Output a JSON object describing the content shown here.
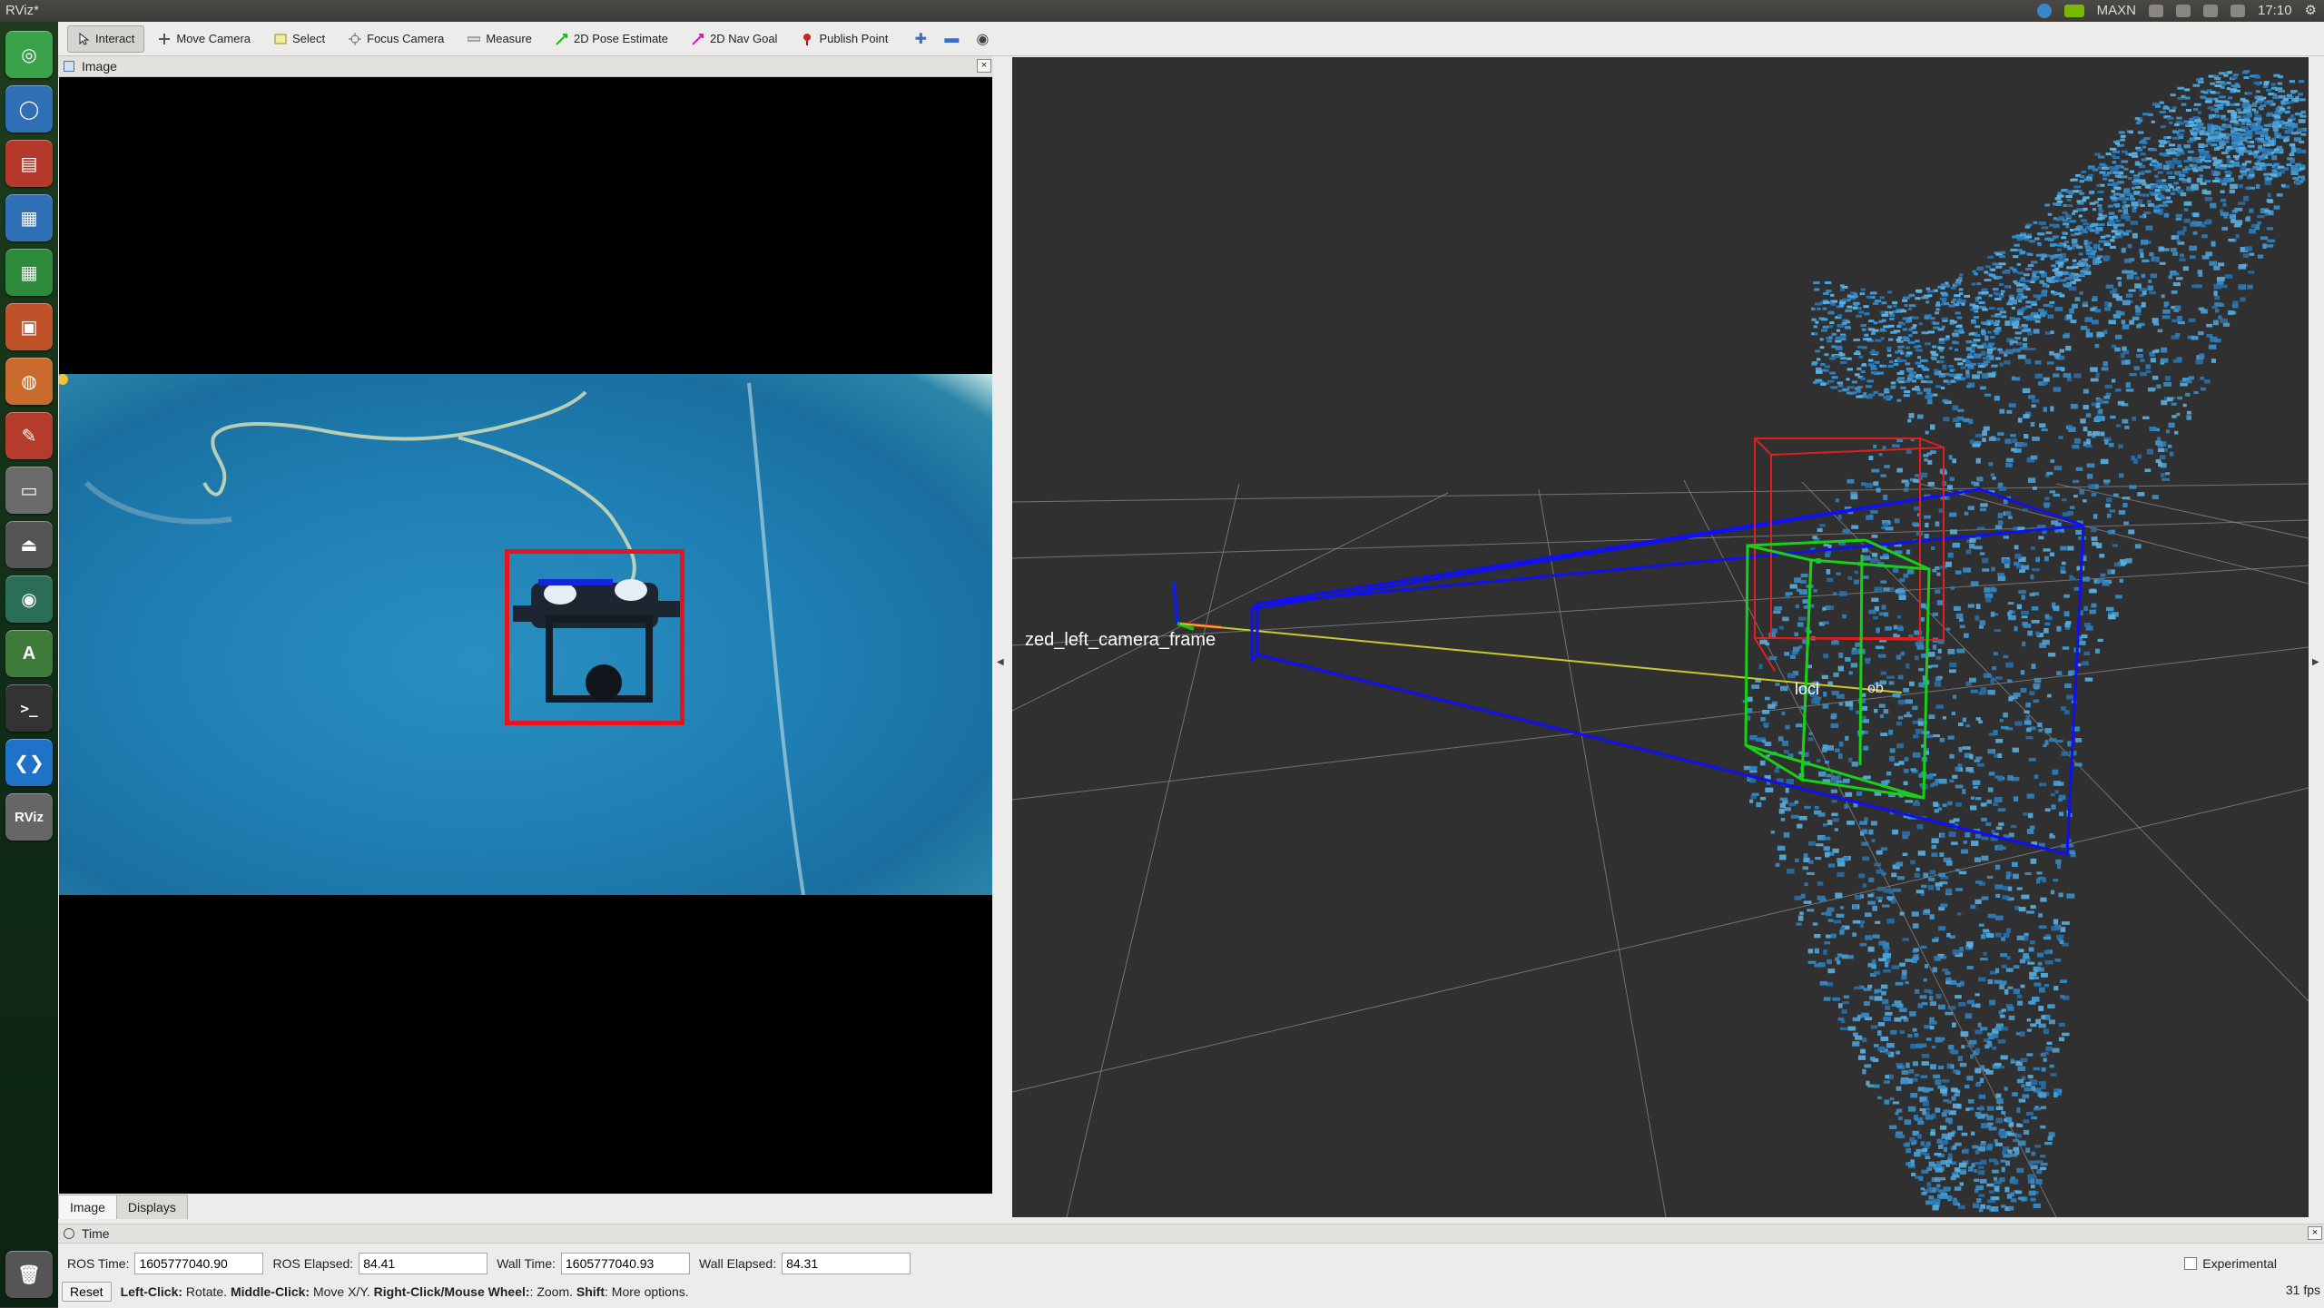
{
  "window": {
    "title": "RViz*"
  },
  "tray": {
    "power_mode": "MAXN",
    "clock": "17:10"
  },
  "launcher": {
    "items": [
      {
        "name": "ubuntu-dash",
        "icon": "ubuntu-icon",
        "color": "#3aa34a"
      },
      {
        "name": "chromium",
        "icon": "browser-icon",
        "color": "#2f6fb5"
      },
      {
        "name": "files",
        "icon": "file-cabinet-icon",
        "color": "#b4392a"
      },
      {
        "name": "writer",
        "icon": "document-icon",
        "color": "#2f6fb5"
      },
      {
        "name": "calc",
        "icon": "spreadsheet-icon",
        "color": "#2e8b3c"
      },
      {
        "name": "impress",
        "icon": "presentation-icon",
        "color": "#c0522a"
      },
      {
        "name": "app-store",
        "icon": "shopping-bag-icon",
        "color": "#c96b2c"
      },
      {
        "name": "system-settings",
        "icon": "wrench-icon",
        "color": "#b53b2a"
      },
      {
        "name": "disk",
        "icon": "drive-icon",
        "color": "#6b6b6b"
      },
      {
        "name": "device",
        "icon": "usb-drive-icon",
        "color": "#555"
      },
      {
        "name": "browser-2",
        "icon": "globe-icon",
        "color": "#2a6e57"
      },
      {
        "name": "software-updater",
        "icon": "updater-icon",
        "color": "#3c7b3a"
      },
      {
        "name": "terminal",
        "icon": "terminal-icon",
        "color": "#333"
      },
      {
        "name": "vscode",
        "icon": "code-icon",
        "color": "#1e73c8"
      },
      {
        "name": "rviz",
        "icon": "rviz-icon",
        "label": "RViz",
        "color": "#666"
      }
    ],
    "trash_icon": "trash-icon"
  },
  "toolbar": {
    "tools": [
      {
        "label": "Interact",
        "icon": "cursor-icon",
        "active": true
      },
      {
        "label": "Move Camera",
        "icon": "move-icon"
      },
      {
        "label": "Select",
        "icon": "select-icon"
      },
      {
        "label": "Focus Camera",
        "icon": "focus-icon"
      },
      {
        "label": "Measure",
        "icon": "ruler-icon"
      },
      {
        "label": "2D Pose Estimate",
        "icon": "green-arrow-icon"
      },
      {
        "label": "2D Nav Goal",
        "icon": "magenta-arrow-icon"
      },
      {
        "label": "Publish Point",
        "icon": "pin-icon"
      }
    ]
  },
  "image_panel": {
    "title": "Image",
    "close": "×",
    "tabs": [
      "Image",
      "Displays"
    ],
    "detection_color": "#e8141b"
  },
  "viewport": {
    "frame_label": "zed_left_camera_frame",
    "object_label": "locl",
    "object_label_2": "ob",
    "colors": {
      "frustum": "#1010f0",
      "box_red": "#e02020",
      "box_green": "#18d018",
      "ray": "#c8c830",
      "cloud": "#3b8fc9"
    }
  },
  "time_panel": {
    "title": "Time",
    "close": "×",
    "ros_time_label": "ROS Time:",
    "ros_time": "1605777040.90",
    "ros_elapsed_label": "ROS Elapsed:",
    "ros_elapsed": "84.41",
    "wall_time_label": "Wall Time:",
    "wall_time": "1605777040.93",
    "wall_elapsed_label": "Wall Elapsed:",
    "wall_elapsed": "84.31",
    "experimental_label": "Experimental"
  },
  "status": {
    "reset_label": "Reset",
    "left_click": "Left-Click:",
    "left_click_desc": " Rotate. ",
    "middle_click": "Middle-Click:",
    "middle_click_desc": " Move X/Y. ",
    "right_click": "Right-Click/Mouse Wheel:",
    "right_click_desc": ": Zoom. ",
    "shift": "Shift",
    "shift_desc": ": More options.",
    "fps": "31 fps"
  }
}
